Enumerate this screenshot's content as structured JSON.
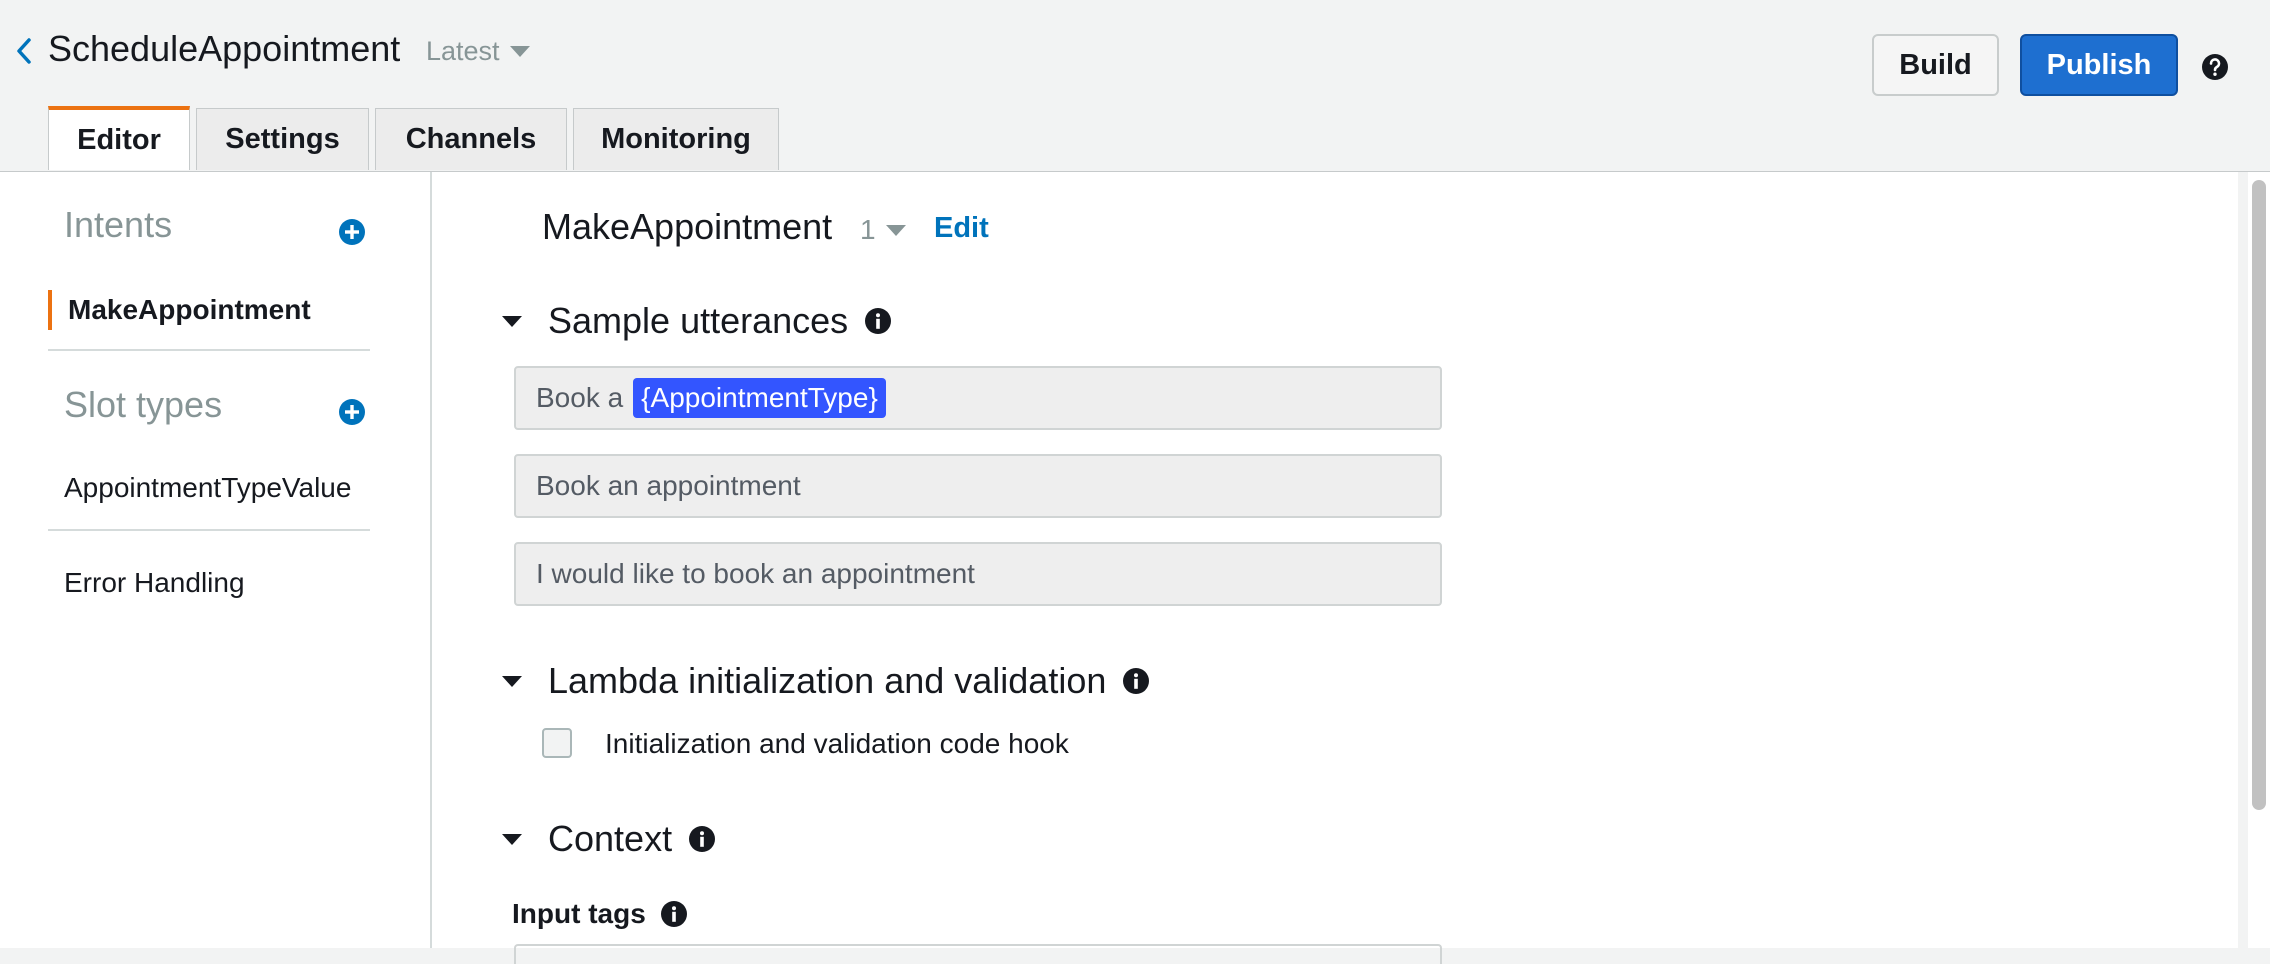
{
  "header": {
    "title": "ScheduleAppointment",
    "version_label": "Latest",
    "build_label": "Build",
    "publish_label": "Publish"
  },
  "tabs": [
    {
      "label": "Editor",
      "active": true
    },
    {
      "label": "Settings",
      "active": false
    },
    {
      "label": "Channels",
      "active": false
    },
    {
      "label": "Monitoring",
      "active": false
    }
  ],
  "sidebar": {
    "intents_title": "Intents",
    "intents": [
      {
        "label": "MakeAppointment",
        "selected": true
      }
    ],
    "slot_types_title": "Slot types",
    "slot_types": [
      {
        "label": "AppointmentTypeValue"
      }
    ],
    "error_handling_label": "Error Handling"
  },
  "main": {
    "intent_name": "MakeAppointment",
    "intent_version": "1",
    "edit_label": "Edit",
    "sample_utterances": {
      "title": "Sample utterances",
      "items": [
        {
          "prefix": "Book a",
          "slot": "{AppointmentType}"
        },
        {
          "text": "Book an appointment"
        },
        {
          "text": "I would like to book an appointment"
        }
      ]
    },
    "lambda": {
      "title": "Lambda initialization and validation",
      "checkbox_label": "Initialization and validation code hook",
      "checked": false
    },
    "context": {
      "title": "Context",
      "input_tags_label": "Input tags"
    }
  },
  "colors": {
    "accent_orange": "#ec7211",
    "publish_blue": "#1e6fd0",
    "link_blue": "#0073bb",
    "slot_chip": "#3355ff"
  },
  "icons": {
    "back": "chevron-left-icon",
    "help": "question-circle-icon",
    "add": "plus-circle-icon",
    "info": "info-icon",
    "dropdown": "caret-down-icon",
    "collapse": "triangle-down-icon"
  }
}
